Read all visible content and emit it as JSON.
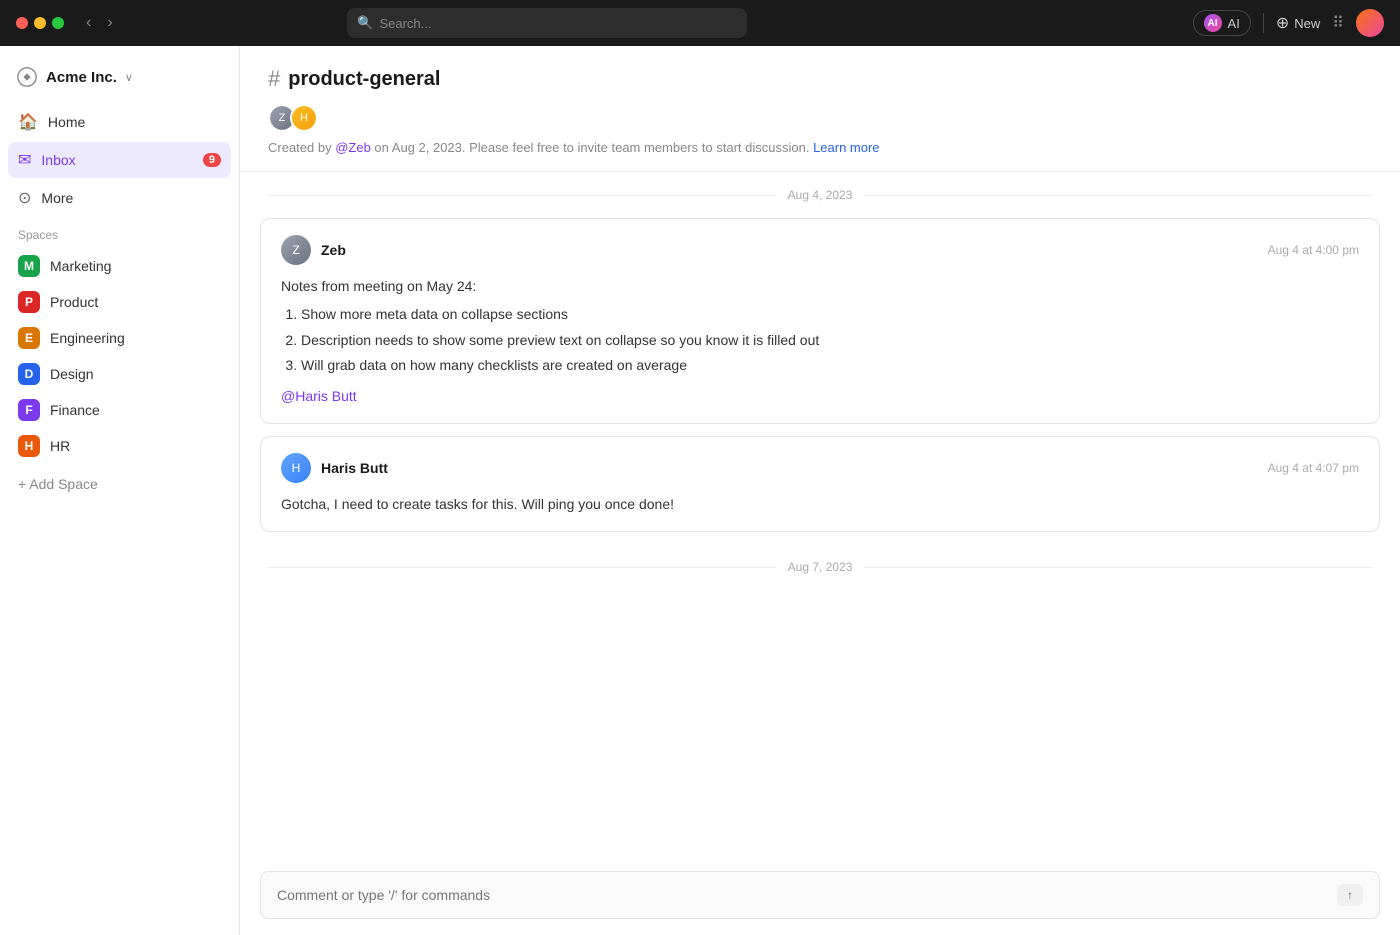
{
  "topbar": {
    "search_placeholder": "Search...",
    "ai_label": "AI",
    "new_label": "New"
  },
  "sidebar": {
    "brand": {
      "name": "Acme Inc.",
      "chevron": "∨"
    },
    "nav": [
      {
        "id": "home",
        "label": "Home",
        "icon": "🏠",
        "active": false
      },
      {
        "id": "inbox",
        "label": "Inbox",
        "icon": "✉",
        "active": true,
        "badge": "9"
      },
      {
        "id": "more",
        "label": "More",
        "icon": "◯",
        "active": false
      }
    ],
    "spaces_label": "Spaces",
    "spaces": [
      {
        "id": "marketing",
        "label": "Marketing",
        "letter": "M",
        "color": "#16a34a"
      },
      {
        "id": "product",
        "label": "Product",
        "letter": "P",
        "color": "#dc2626"
      },
      {
        "id": "engineering",
        "label": "Engineering",
        "letter": "E",
        "color": "#d97706"
      },
      {
        "id": "design",
        "label": "Design",
        "letter": "D",
        "color": "#2563eb"
      },
      {
        "id": "finance",
        "label": "Finance",
        "letter": "F",
        "color": "#7c3aed"
      },
      {
        "id": "hr",
        "label": "HR",
        "letter": "H",
        "color": "#ea580c"
      }
    ],
    "add_space_label": "+ Add Space"
  },
  "channel": {
    "name": "product-general",
    "description_prefix": "Created by ",
    "description_mention": "@Zeb",
    "description_middle": " on Aug 2, 2023. Please feel free to invite team members to start discussion. ",
    "description_link": "Learn more"
  },
  "messages": [
    {
      "date_divider": "Aug 4, 2023",
      "author": "Zeb",
      "avatar_initials": "Z",
      "time": "Aug 4 at 4:00 pm",
      "body_intro": "Notes from meeting on May 24:",
      "items": [
        "Show more meta data on collapse sections",
        "Description needs to show some preview text on collapse so you know it is filled out",
        "Will grab data on how many checklists are created on average"
      ],
      "mention": "@Haris Butt"
    },
    {
      "date_divider": null,
      "author": "Haris Butt",
      "avatar_initials": "H",
      "time": "Aug 4 at 4:07 pm",
      "body_text": "Gotcha, I need to create tasks for this. Will ping you once done!",
      "items": []
    }
  ],
  "second_date_divider": "Aug 7, 2023",
  "comment_box": {
    "placeholder": "Comment or type '/' for commands"
  }
}
